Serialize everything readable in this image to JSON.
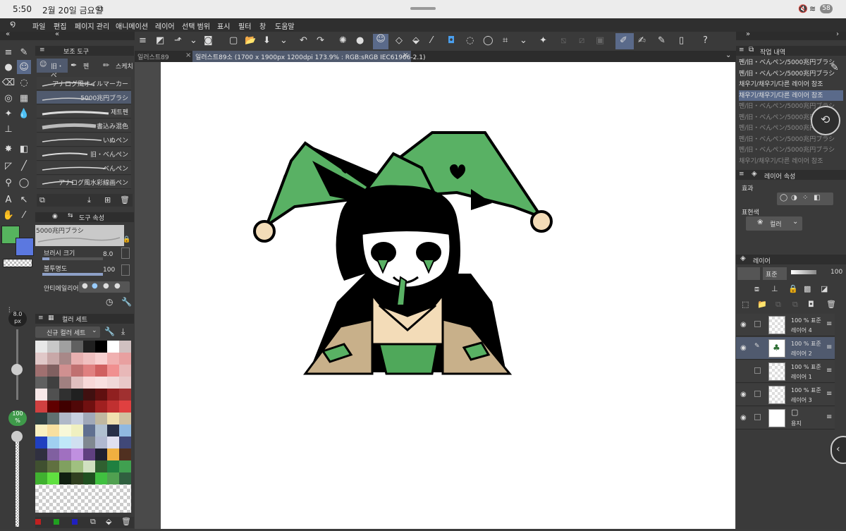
{
  "status": {
    "time": "5:50",
    "date": "2월 20일 금요일",
    "battery": "58"
  },
  "menu": [
    "파일",
    "편집",
    "페이지 관리",
    "애니메이션",
    "레이어",
    "선택 범위",
    "표시",
    "필터",
    "창",
    "도움말"
  ],
  "left": {
    "subtool_tab": "보조 도구",
    "subtool_group_tabs": [
      "旧・べ",
      "펜",
      "스케치"
    ],
    "brushes": [
      "アナログ風オイルマーカー",
      "5000兆円ブラシ",
      "제트펜",
      "書込み混色",
      "いぬペン",
      "旧・べんぺン",
      "べんぺン",
      "アナログ風水彩線画ペン"
    ],
    "tool_property_tab": "도구 속성",
    "current_brush": "5000兆円ブラシ",
    "brush_size_label": "브러시 크기",
    "brush_size_value": "8.0",
    "opacity_label": "불투명도",
    "opacity_value": "100",
    "antialias_label": "안티에일리어싱",
    "size_readout": "8.0",
    "size_unit": "px",
    "opacity_readout": "100",
    "opacity_unit": "%",
    "color_set_tab": "컬러 세트",
    "color_set_name": "신규 컬러 세트",
    "main_color": "#56b45e",
    "sub_color": "#5b78e0"
  },
  "tabs": {
    "inactive": "일러스트89",
    "active": "일러스트89소 (1700 x 1900px 1200dpi 173.9% : RGB:sRGB IEC61966-2.1)"
  },
  "right": {
    "history_tab": "작업 내역",
    "history": [
      {
        "text": "펜/旧・べんぺン/5000兆円ブラシ",
        "state": "normal"
      },
      {
        "text": "펜/旧・べんぺン/5000兆円ブラシ",
        "state": "normal"
      },
      {
        "text": "채우기/채우기/다른 레이어 참조",
        "state": "normal"
      },
      {
        "text": "채우기/채우기/다른 레이어 참조",
        "state": "sel"
      },
      {
        "text": "펜/旧・べんぺン/5000兆円ブラシ",
        "state": "dim"
      },
      {
        "text": "펜/旧・べんぺン/5000兆円ブラシ",
        "state": "dim"
      },
      {
        "text": "펜/旧・べんぺン/5000兆円ブラシ",
        "state": "dim"
      },
      {
        "text": "펜/旧・べんぺン/5000兆円ブラシ",
        "state": "dim"
      },
      {
        "text": "펜/旧・べんぺン/5000兆円ブラシ",
        "state": "dim"
      },
      {
        "text": "채우기/채우기/다른 레이어 참조",
        "state": "dim"
      }
    ],
    "layer_property_tab": "레이어 속성",
    "effect_label": "효과",
    "express_label": "표현색",
    "express_value": "컬러",
    "layer_tab": "레이어",
    "blend_mode": "표준",
    "layer_opacity": "100",
    "layers": [
      {
        "pct": "100 % 표준",
        "name": "레이어 4",
        "visible": true,
        "sel": false,
        "paper": false
      },
      {
        "pct": "100 % 표준",
        "name": "레이어 2",
        "visible": true,
        "sel": true,
        "paper": false
      },
      {
        "pct": "100 % 표준",
        "name": "레이어 1",
        "visible": false,
        "sel": false,
        "paper": false
      },
      {
        "pct": "100 % 표준",
        "name": "레이어 3",
        "visible": true,
        "sel": false,
        "paper": false
      },
      {
        "pct": "",
        "name": "용지",
        "visible": true,
        "sel": false,
        "paper": true
      }
    ]
  }
}
